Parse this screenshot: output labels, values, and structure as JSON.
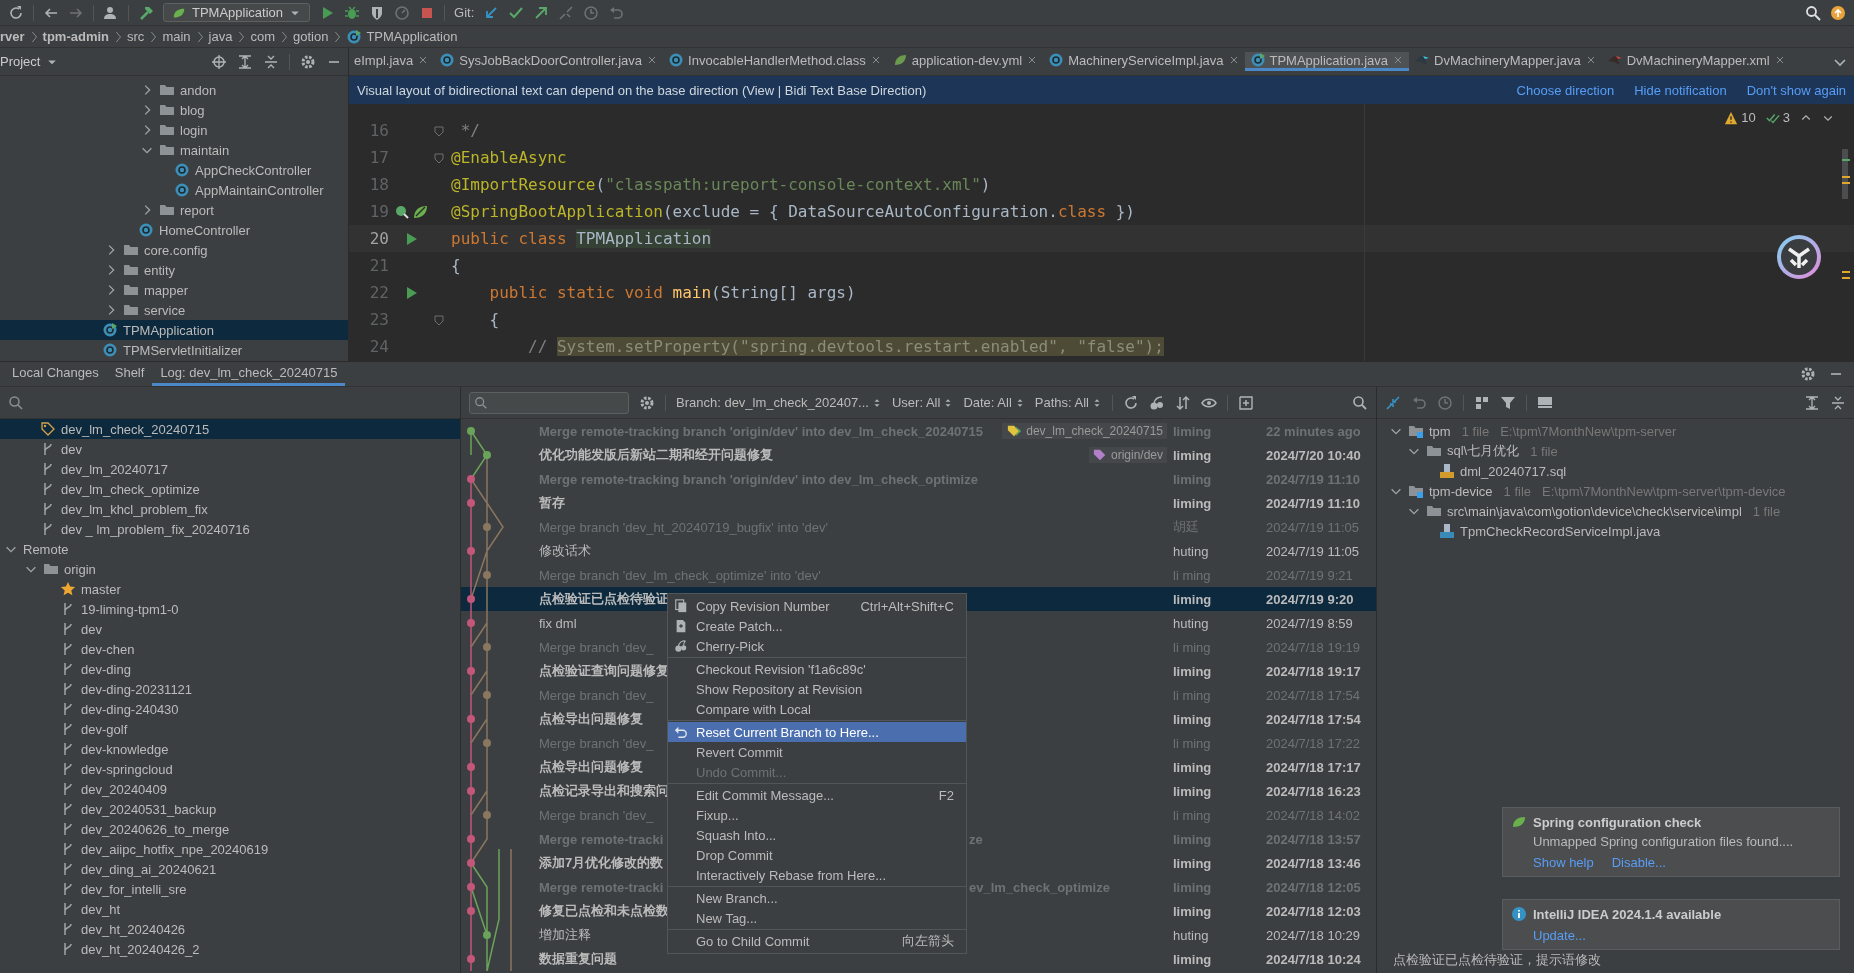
{
  "toolbar": {
    "run_config": "TPMApplication",
    "vcs_label": "Git:"
  },
  "breadcrumbs": [
    {
      "label": "rver",
      "bold": true
    },
    {
      "label": "tpm-admin",
      "bold": true
    },
    {
      "label": "src",
      "bold": false
    },
    {
      "label": "main",
      "bold": false
    },
    {
      "label": "java",
      "bold": false
    },
    {
      "label": "com",
      "bold": false
    },
    {
      "label": "gotion",
      "bold": false
    },
    {
      "label": "TPMApplication",
      "bold": false
    }
  ],
  "project_panel": {
    "title": "Project",
    "items": [
      {
        "children": [
          {
            "label": "andon",
            "kind": "folder",
            "expanded": false,
            "selected": false
          },
          {
            "label": "blog",
            "kind": "folder",
            "expanded": false,
            "selected": false
          },
          {
            "label": "login",
            "kind": "folder",
            "expanded": false,
            "selected": false
          },
          {
            "label": "maintain",
            "kind": "folder",
            "expanded": true,
            "selected": false,
            "children": [
              {
                "label": "AppCheckController",
                "kind": "class",
                "selected": false
              },
              {
                "label": "AppMaintainController",
                "kind": "class",
                "selected": false
              }
            ]
          },
          {
            "label": "report",
            "kind": "folder",
            "expanded": false,
            "selected": false
          },
          {
            "label": "HomeController",
            "kind": "class",
            "selected": false
          }
        ]
      },
      {
        "label": "core.config",
        "kind": "folder",
        "expanded": false,
        "selected": false
      },
      {
        "label": "entity",
        "kind": "folder",
        "expanded": false,
        "selected": false
      },
      {
        "label": "mapper",
        "kind": "folder",
        "expanded": false,
        "selected": false
      },
      {
        "label": "service",
        "kind": "folder",
        "expanded": false,
        "selected": false
      },
      {
        "label": "TPMApplication",
        "kind": "app",
        "selected": true
      },
      {
        "label": "TPMServletInitializer",
        "kind": "class",
        "selected": false
      }
    ]
  },
  "editor": {
    "tabs": [
      {
        "label": "eImpl.java",
        "selected": false
      },
      {
        "label": "SysJobBackDoorController.java",
        "kind": "class",
        "selected": false
      },
      {
        "label": "InvocableHandlerMethod.class",
        "kind": "class",
        "selected": false
      },
      {
        "label": "application-dev.yml",
        "kind": "yaml",
        "selected": false
      },
      {
        "label": "MachineryServiceImpl.java",
        "kind": "class",
        "selected": false
      },
      {
        "label": "TPMApplication.java",
        "kind": "app",
        "selected": true
      },
      {
        "label": "DvMachineryMapper.java",
        "kind": "mapper",
        "selected": false
      },
      {
        "label": "DvMachineryMapper.xml",
        "kind": "xml",
        "selected": false
      }
    ],
    "banner": {
      "text": "Visual layout of bidirectional text can depend on the base direction (View | Bidi Text Base Direction)",
      "actions": [
        "Choose direction",
        "Hide notification",
        "Don't show again"
      ]
    },
    "inspections": {
      "warnings": "10",
      "checks": "3"
    },
    "lines": [
      {
        "number": "16",
        "current": false,
        "kind": "fold",
        "tokens": [
          {
            "text": " */",
            "kind": "comment"
          }
        ]
      },
      {
        "number": "17",
        "current": false,
        "kind": "fold",
        "tokens": [
          {
            "text": "@EnableAsync",
            "kind": "annotation"
          }
        ]
      },
      {
        "number": "18",
        "current": false,
        "kind": "plain",
        "tokens": [
          {
            "text": "@ImportResource",
            "kind": "annotation"
          },
          {
            "text": "(",
            "kind": "plain"
          },
          {
            "text": "\"classpath:ureport-console-context.xml\"",
            "kind": "string"
          },
          {
            "text": ")",
            "kind": "plain"
          }
        ]
      },
      {
        "number": "19",
        "current": false,
        "kind": "spring",
        "tokens": [
          {
            "text": "@SpringBootApplication",
            "kind": "annotation"
          },
          {
            "text": "(exclude = { DataSourceAutoConfiguration.",
            "kind": "plain"
          },
          {
            "text": "class",
            "kind": "keyword"
          },
          {
            "text": " })",
            "kind": "plain"
          }
        ]
      },
      {
        "number": "20",
        "current": true,
        "kind": "run",
        "tokens": [
          {
            "text": "public class ",
            "kind": "keyword"
          },
          {
            "text": "TPMApplication",
            "kind": "decl"
          }
        ]
      },
      {
        "number": "21",
        "current": false,
        "kind": "plain",
        "tokens": [
          {
            "text": "{",
            "kind": "plain"
          }
        ]
      },
      {
        "number": "22",
        "current": false,
        "kind": "run",
        "tokens": [
          {
            "text": "    public static void ",
            "kind": "keyword"
          },
          {
            "text": "main",
            "kind": "method"
          },
          {
            "text": "(String[] args)",
            "kind": "plain"
          }
        ]
      },
      {
        "number": "23",
        "current": false,
        "kind": "fold",
        "tokens": [
          {
            "text": "    {",
            "kind": "plain"
          }
        ]
      },
      {
        "number": "24",
        "current": false,
        "kind": "plain",
        "tokens": [
          {
            "text": "        // ",
            "kind": "comment"
          },
          {
            "text": "System.setProperty(\"spring.devtools.restart.enabled\", \"false\");",
            "kind": "highlighted"
          }
        ]
      }
    ]
  },
  "tool_tabs": [
    {
      "label": "Local Changes",
      "selected": false
    },
    {
      "label": "Shelf",
      "selected": false
    },
    {
      "label": "Log: dev_lm_check_20240715",
      "selected": true
    }
  ],
  "branches": {
    "items": [
      {
        "children": [
          {
            "label": "dev_lm_check_20240715",
            "kind": "tag",
            "selected": true
          },
          {
            "label": "dev",
            "kind": "branch",
            "selected": false
          },
          {
            "label": "dev_lm_20240717",
            "kind": "branch",
            "selected": false
          },
          {
            "label": "dev_lm_check_optimize",
            "kind": "branch",
            "selected": false
          },
          {
            "label": "dev_lm_khcl_problem_fix",
            "kind": "branch",
            "selected": false
          },
          {
            "label": "dev _ lm_problem_fix_20240716",
            "kind": "branch",
            "selected": false
          }
        ]
      },
      {
        "label": "Remote",
        "expanded": true,
        "selected": false,
        "children": [
          {
            "label": "origin",
            "kind": "folder",
            "expanded": true,
            "selected": false,
            "children": [
              {
                "label": "master",
                "kind": "star",
                "selected": false
              },
              {
                "label": "19-liming-tpm1-0",
                "kind": "branch",
                "selected": false
              },
              {
                "label": "dev",
                "kind": "branch",
                "selected": false
              },
              {
                "label": "dev-chen",
                "kind": "branch",
                "selected": false
              },
              {
                "label": "dev-ding",
                "kind": "branch",
                "selected": false
              },
              {
                "label": "dev-ding-20231121",
                "kind": "branch",
                "selected": false
              },
              {
                "label": "dev-ding-240430",
                "kind": "branch",
                "selected": false
              },
              {
                "label": "dev-golf",
                "kind": "branch",
                "selected": false
              },
              {
                "label": "dev-knowledge",
                "kind": "branch",
                "selected": false
              },
              {
                "label": "dev-springcloud",
                "kind": "branch",
                "selected": false
              },
              {
                "label": "dev_20240409",
                "kind": "branch",
                "selected": false
              },
              {
                "label": "dev_20240531_backup",
                "kind": "branch",
                "selected": false
              },
              {
                "label": "dev_20240626_to_merge",
                "kind": "branch",
                "selected": false
              },
              {
                "label": "dev_aiipc_hotfix_npe_20240619",
                "kind": "branch",
                "selected": false
              },
              {
                "label": "dev_ding_ai_20240621",
                "kind": "branch",
                "selected": false
              },
              {
                "label": "dev_for_intelli_sre",
                "kind": "branch",
                "selected": false
              },
              {
                "label": "dev_ht",
                "kind": "branch",
                "selected": false
              },
              {
                "label": "dev_ht_20240426",
                "kind": "branch",
                "selected": false
              },
              {
                "label": "dev_ht_20240426_2",
                "kind": "branch",
                "selected": false
              }
            ]
          }
        ]
      }
    ]
  },
  "log": {
    "filters": [
      "Branch: dev_lm_check_202407...",
      "User: All",
      "Date: All",
      "Paths: All"
    ],
    "rows": [
      {
        "message": "Merge remote-tracking branch 'origin/dev' into dev_lm_check_20240715",
        "kind": "merge",
        "bold": true,
        "selected": false,
        "tag": {
          "label": "dev_lm_check_20240715",
          "kind": "local"
        },
        "author": "liming",
        "date": "22 minutes ago"
      },
      {
        "message": "优化功能发版后新站二期和经开问题修复",
        "kind": "commit",
        "bold": true,
        "selected": false,
        "tag": {
          "label": "origin/dev",
          "kind": "remote"
        },
        "author": "liming",
        "date": "2024/7/20 10:40"
      },
      {
        "message": "Merge remote-tracking branch 'origin/dev' into dev_lm_check_optimize",
        "kind": "merge",
        "bold": true,
        "selected": false,
        "author": "liming",
        "date": "2024/7/19 11:10"
      },
      {
        "message": "暂存",
        "kind": "commit",
        "bold": true,
        "selected": false,
        "author": "liming",
        "date": "2024/7/19 11:10"
      },
      {
        "message": "Merge branch 'dev_ht_20240719_bugfix' into 'dev'",
        "kind": "merge",
        "bold": false,
        "selected": false,
        "author": "胡廷",
        "date": "2024/7/19 11:05"
      },
      {
        "message": "修改话术",
        "kind": "commit",
        "bold": false,
        "selected": false,
        "author": "huting",
        "date": "2024/7/19 11:05"
      },
      {
        "message": "Merge branch 'dev_lm_check_optimize' into 'dev'",
        "kind": "merge",
        "bold": false,
        "selected": false,
        "author": "li ming",
        "date": "2024/7/19 9:21"
      },
      {
        "message": "点检验证已点检待验证",
        "kind": "commit",
        "bold": true,
        "selected": true,
        "author": "liming",
        "date": "2024/7/19 9:20"
      },
      {
        "message": "fix dml",
        "kind": "commit",
        "bold": false,
        "selected": false,
        "author": "huting",
        "date": "2024/7/19 8:59"
      },
      {
        "message": "Merge branch 'dev_",
        "kind": "merge",
        "bold": false,
        "selected": false,
        "author": "li ming",
        "date": "2024/7/18 19:19"
      },
      {
        "message": "点检验证查询问题修复",
        "kind": "commit",
        "bold": true,
        "selected": false,
        "author": "liming",
        "date": "2024/7/18 19:17"
      },
      {
        "message": "Merge branch 'dev_",
        "kind": "merge",
        "bold": false,
        "selected": false,
        "author": "li ming",
        "date": "2024/7/18 17:54"
      },
      {
        "message": "点检导出问题修复",
        "kind": "commit",
        "bold": true,
        "selected": false,
        "author": "liming",
        "date": "2024/7/18 17:54"
      },
      {
        "message": "Merge branch 'dev_",
        "kind": "merge",
        "bold": false,
        "selected": false,
        "author": "li ming",
        "date": "2024/7/18 17:22"
      },
      {
        "message": "点检导出问题修复",
        "kind": "commit",
        "bold": true,
        "selected": false,
        "author": "liming",
        "date": "2024/7/18 17:17"
      },
      {
        "message": "点检记录导出和搜索问",
        "kind": "commit",
        "bold": true,
        "selected": false,
        "author": "liming",
        "date": "2024/7/18 16:23"
      },
      {
        "message": "Merge branch 'dev_",
        "kind": "merge",
        "bold": false,
        "selected": false,
        "author": "li ming",
        "date": "2024/7/18 14:02"
      },
      {
        "message": "Merge remote-tracki",
        "tail": "ze",
        "kind": "merge",
        "bold": true,
        "selected": false,
        "author": "liming",
        "date": "2024/7/18 13:57"
      },
      {
        "message": "添加7月优化修改的数",
        "kind": "commit",
        "bold": true,
        "selected": false,
        "author": "liming",
        "date": "2024/7/18 13:46"
      },
      {
        "message": "Merge remote-tracki",
        "tail": "ev_lm_check_optimize",
        "kind": "merge",
        "bold": true,
        "selected": false,
        "author": "liming",
        "date": "2024/7/18 12:05"
      },
      {
        "message": "修复已点检和未点检数",
        "kind": "commit",
        "bold": true,
        "selected": false,
        "author": "liming",
        "date": "2024/7/18 12:03"
      },
      {
        "message": "增加注释",
        "kind": "commit",
        "bold": false,
        "selected": false,
        "author": "huting",
        "date": "2024/7/18 10:29"
      },
      {
        "message": "数据重复问题",
        "kind": "commit",
        "bold": true,
        "selected": false,
        "author": "liming",
        "date": "2024/7/18 10:24"
      }
    ]
  },
  "context_menu": {
    "items": [
      {
        "label": "Copy Revision Number",
        "kind": "copy",
        "shortcut": "Ctrl+Alt+Shift+C",
        "selected": false,
        "disabled": false
      },
      {
        "label": "Create Patch...",
        "kind": "patch",
        "selected": false,
        "disabled": false
      },
      {
        "label": "Cherry-Pick",
        "kind": "cherry",
        "selected": false,
        "disabled": false
      },
      {
        "label": "Checkout Revision 'f1a6c89c'",
        "separator_before": true,
        "selected": false,
        "disabled": false
      },
      {
        "label": "Show Repository at Revision",
        "selected": false,
        "disabled": false
      },
      {
        "label": "Compare with Local",
        "selected": false,
        "disabled": false
      },
      {
        "label": "Reset Current Branch to Here...",
        "kind": "reset",
        "separator_before": true,
        "selected": true,
        "disabled": false
      },
      {
        "label": "Revert Commit",
        "selected": false,
        "disabled": false
      },
      {
        "label": "Undo Commit...",
        "selected": false,
        "disabled": true
      },
      {
        "label": "Edit Commit Message...",
        "shortcut": "F2",
        "separator_before": true,
        "selected": false,
        "disabled": false
      },
      {
        "label": "Fixup...",
        "selected": false,
        "disabled": false
      },
      {
        "label": "Squash Into...",
        "selected": false,
        "disabled": false
      },
      {
        "label": "Drop Commit",
        "selected": false,
        "disabled": false
      },
      {
        "label": "Interactively Rebase from Here...",
        "selected": false,
        "disabled": false
      },
      {
        "label": "New Branch...",
        "separator_before": true,
        "selected": false,
        "disabled": false
      },
      {
        "label": "New Tag...",
        "selected": false,
        "disabled": false
      },
      {
        "label": "Go to Child Commit",
        "shortcut": "向左箭头",
        "separator_before": true,
        "selected": false,
        "disabled": false
      }
    ]
  },
  "changes": {
    "items": [
      {
        "label": "tpm",
        "kind": "module",
        "count": "1 file",
        "path": "E:\\tpm\\7MonthNew\\tpm-server",
        "expanded": true,
        "children": [
          {
            "label": "sql\\七月优化",
            "kind": "folder",
            "count": "1 file",
            "expanded": true,
            "children": [
              {
                "label": "dml_20240717.sql",
                "kind": "sql"
              }
            ]
          }
        ]
      },
      {
        "label": "tpm-device",
        "kind": "module",
        "count": "1 file",
        "path": "E:\\tpm\\7MonthNew\\tpm-server\\tpm-device",
        "expanded": true,
        "children": [
          {
            "label": "src\\main\\java\\com\\gotion\\device\\check\\service\\impl",
            "kind": "folder",
            "count": "1 file",
            "expanded": true,
            "children": [
              {
                "label": "TpmCheckRecordServiceImpl.java",
                "kind": "java"
              }
            ]
          }
        ]
      }
    ]
  },
  "notifications": [
    {
      "kind": "spring",
      "title": "Spring configuration check",
      "text": "Unmapped Spring configuration files found....",
      "actions": [
        "Show help",
        "Disable..."
      ]
    },
    {
      "kind": "info",
      "title": "IntelliJ IDEA 2024.1.4 available",
      "actions": [
        "Update..."
      ]
    }
  ],
  "commit_details": {
    "message": "点检验证已点检待验证，提示语修改"
  }
}
